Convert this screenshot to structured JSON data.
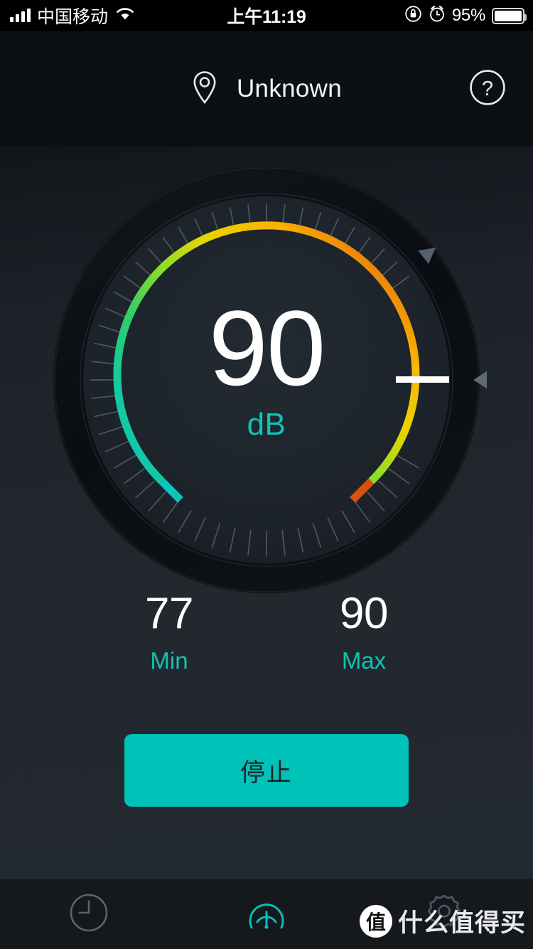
{
  "status_bar": {
    "carrier": "中国移动",
    "time": "上午11:19",
    "battery_percent": "95%",
    "icons": [
      "signal-bars-icon",
      "wifi-icon",
      "rotation-lock-icon",
      "alarm-clock-icon",
      "battery-icon"
    ]
  },
  "header": {
    "location_icon": "location-pin-icon",
    "title": "Unknown",
    "help_icon": "help-circle-icon"
  },
  "gauge": {
    "value": "90",
    "unit": "dB",
    "min_angle_deg": -215,
    "max_angle_deg": 35,
    "needle_angle_deg": 0,
    "peak_marker_angle_deg": -38,
    "colors": {
      "arc_start": "#0fc7b4",
      "arc_green": "#3ecf5a",
      "arc_light_green": "#8ede2a",
      "arc_yellow": "#f5d800",
      "arc_orange": "#f59b00",
      "arc_end": "#e05a14",
      "needle": "#ffffff",
      "marker": "#5d6a78",
      "tick": "#6d7883",
      "ring_outer": "#0a0d10",
      "ring_inner": "#1b2025",
      "accent": "#0dc5b5"
    }
  },
  "stats": {
    "min": {
      "value": "77",
      "label": "Min"
    },
    "max": {
      "value": "90",
      "label": "Max"
    }
  },
  "action": {
    "label": "停止"
  },
  "tabbar": {
    "items": [
      {
        "name": "history",
        "icon": "clock-icon",
        "active": false
      },
      {
        "name": "meter",
        "icon": "gauge-icon",
        "active": true
      },
      {
        "name": "settings",
        "icon": "gear-icon",
        "active": false
      }
    ],
    "active_color": "#00c2b8",
    "inactive_color": "#5a646e"
  },
  "watermark": {
    "badge": "值",
    "text": "什么值得买"
  }
}
